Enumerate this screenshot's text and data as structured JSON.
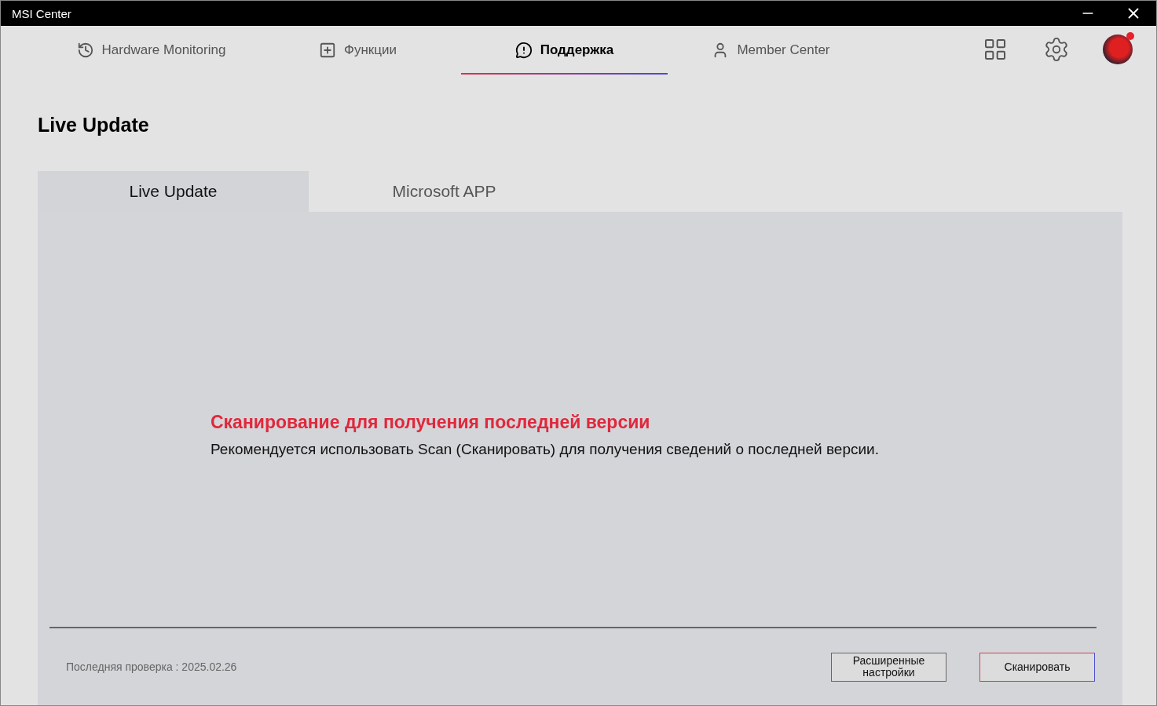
{
  "window": {
    "title": "MSI Center"
  },
  "nav": [
    {
      "kind": "monitor",
      "label": "Hardware Monitoring",
      "selected": false
    },
    {
      "kind": "features",
      "label": "Функции",
      "selected": false
    },
    {
      "kind": "support",
      "label": "Поддержка",
      "selected": true
    },
    {
      "kind": "member",
      "label": "Member Center",
      "selected": false
    }
  ],
  "avatar": {
    "notification": true
  },
  "page_title": "Live Update",
  "tabs": [
    {
      "label": "Live Update",
      "selected": true
    },
    {
      "label": "Microsoft APP",
      "selected": false
    }
  ],
  "message": {
    "title": "Сканирование для получения последней версии",
    "body": "Рекомендуется использовать Scan (Сканировать) для получения сведений о последней версии."
  },
  "footer": {
    "last_check": "Последняя проверка : 2025.02.26",
    "buttons": [
      {
        "kind": "plain",
        "label": "Расширенные настройки"
      },
      {
        "kind": "primary",
        "label": "Сканировать"
      }
    ]
  }
}
